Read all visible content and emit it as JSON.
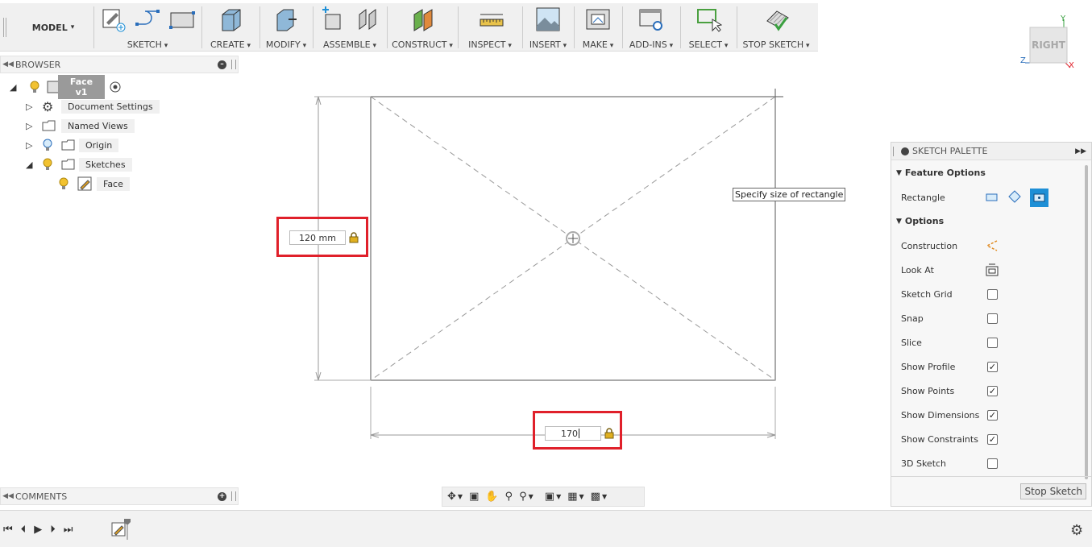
{
  "toolbar": {
    "model_label": "MODEL",
    "groups": {
      "sketch": "SKETCH",
      "create": "CREATE",
      "modify": "MODIFY",
      "assemble": "ASSEMBLE",
      "construct": "CONSTRUCT",
      "inspect": "INSPECT",
      "insert": "INSERT",
      "make": "MAKE",
      "addins": "ADD-INS",
      "select": "SELECT",
      "stop_sketch": "STOP SKETCH"
    }
  },
  "viewcube": {
    "face": "RIGHT",
    "axis_y": "Y",
    "axis_z": "Z",
    "axis_x": "X"
  },
  "browser": {
    "title": "BROWSER",
    "items": [
      {
        "label": "Face v1",
        "icon": "component-icon"
      },
      {
        "label": "Document Settings",
        "icon": "gear-icon"
      },
      {
        "label": "Named Views",
        "icon": "folder-icon"
      },
      {
        "label": "Origin",
        "icon": "folder-icon"
      },
      {
        "label": "Sketches",
        "icon": "folder-icon"
      },
      {
        "label": "Face",
        "icon": "sketch-icon"
      }
    ]
  },
  "comments": {
    "title": "COMMENTS"
  },
  "canvas": {
    "height_dim_value": "120 mm",
    "width_dim_value": "170",
    "tooltip": "Specify size of rectangle"
  },
  "palette": {
    "title": "SKETCH PALETTE",
    "feature_options_label": "Feature Options",
    "rectangle_label": "Rectangle",
    "options_label": "Options",
    "options": [
      {
        "label": "Construction",
        "type": "icon"
      },
      {
        "label": "Look At",
        "type": "icon"
      },
      {
        "label": "Sketch Grid",
        "checked": false
      },
      {
        "label": "Snap",
        "checked": false
      },
      {
        "label": "Slice",
        "checked": false
      },
      {
        "label": "Show Profile",
        "checked": true
      },
      {
        "label": "Show Points",
        "checked": true
      },
      {
        "label": "Show Dimensions",
        "checked": true
      },
      {
        "label": "Show Constraints",
        "checked": true
      },
      {
        "label": "3D Sketch",
        "checked": false
      }
    ],
    "stop_button": "Stop Sketch"
  },
  "colors": {
    "highlight_red": "#e0202a",
    "accent_blue": "#1e8fd6",
    "bulb_yellow": "#f2c230"
  }
}
